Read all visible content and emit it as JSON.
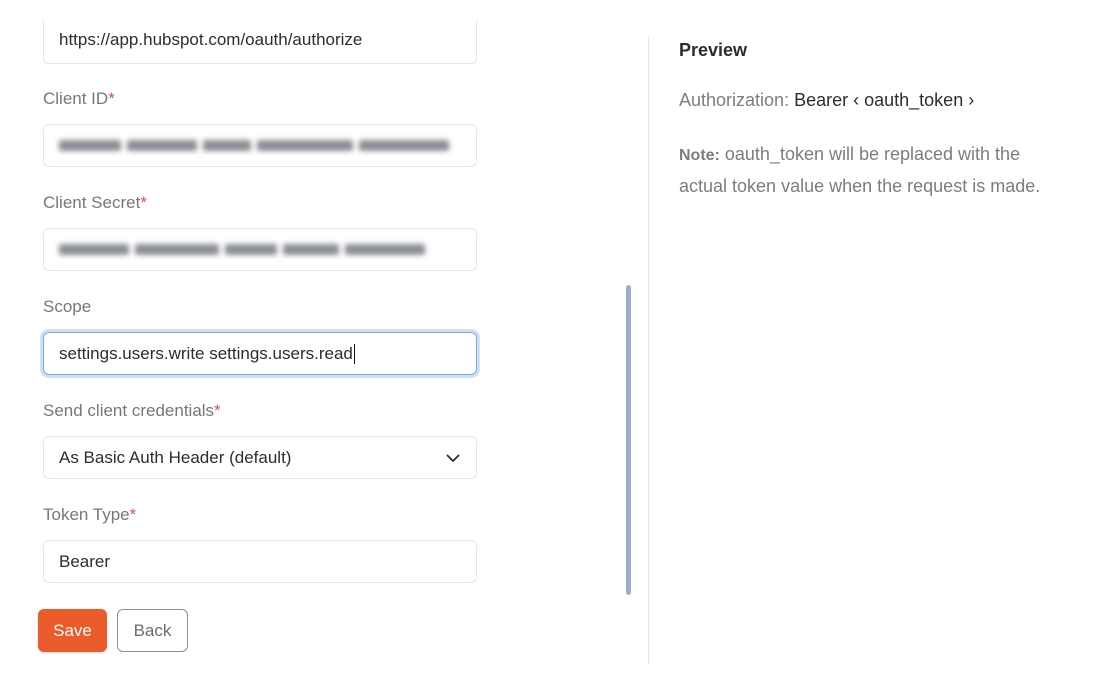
{
  "form": {
    "auth_url_value": "https://app.hubspot.com/oauth/authorize",
    "client_id": {
      "label": "Client ID",
      "required_mark": "*"
    },
    "client_secret": {
      "label": "Client Secret",
      "required_mark": "*"
    },
    "scope": {
      "label": "Scope",
      "value": "settings.users.write settings.users.read"
    },
    "send_credentials": {
      "label": "Send client credentials",
      "required_mark": "*",
      "selected": "As Basic Auth Header (default)"
    },
    "token_type": {
      "label": "Token Type",
      "required_mark": "*",
      "value": "Bearer"
    },
    "save_label": "Save",
    "back_label": "Back"
  },
  "preview": {
    "title": "Preview",
    "auth_key": "Authorization:",
    "auth_value": "Bearer ‹ oauth_token ›",
    "note_label": "Note:",
    "note_text": " oauth_token will be replaced with the actual token value when the request is made."
  },
  "colors": {
    "accent": "#ea5a2a",
    "required": "#d9534f",
    "focus": "#7aa7e6"
  }
}
